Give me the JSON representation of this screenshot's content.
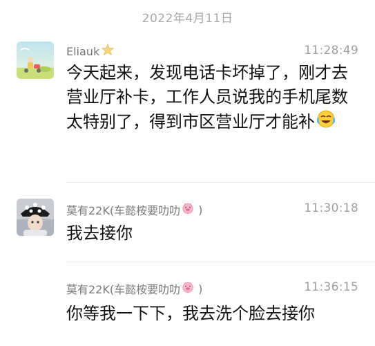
{
  "date_divider": "2022年4月11日",
  "messages": [
    {
      "sender": "Eliauk",
      "sender_badge_icon": "star-badge-icon",
      "time": "11:28:49",
      "text": "今天起来，发现电话卡坏掉了，刚才去营业厅补卡，工作人员说我的手机尾数太特别了，得到市区营业厅才能补",
      "trailing_emoji": "laughing-crying-emoji"
    },
    {
      "sender": "莫有22K(车懿桉要叻叻",
      "sender_suffix": ")",
      "sender_emoji": "pig-face-emoji",
      "time": "11:30:18",
      "text": "我去接你"
    },
    {
      "sender": "莫有22K(车懿桉要叻叻",
      "sender_suffix": ")",
      "sender_emoji": "pig-face-emoji",
      "time": "11:36:15",
      "text": "你等我一下下，我去洗个脸去接你"
    }
  ]
}
